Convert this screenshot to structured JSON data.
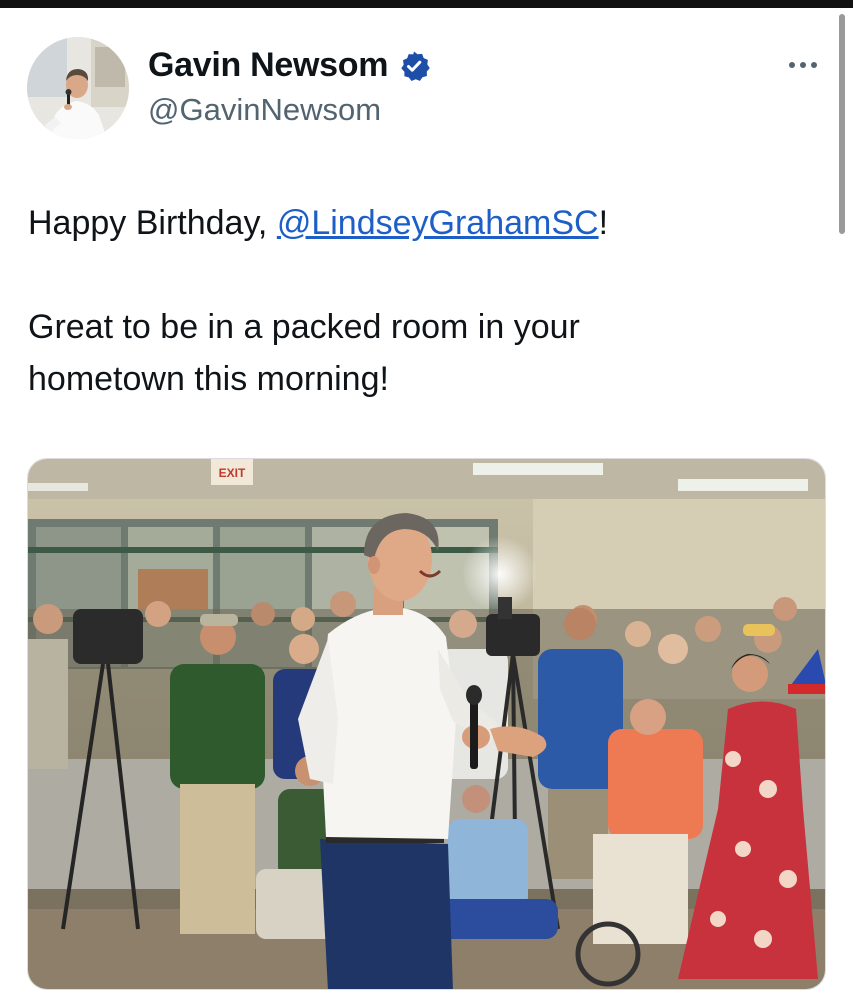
{
  "post": {
    "author": {
      "display_name": "Gavin Newsom",
      "handle": "@GavinNewsom",
      "verified": true,
      "avatar_icon": "profile-photo",
      "verified_icon": "verified-badge-icon"
    },
    "text": {
      "line1_prefix": "Happy Birthday, ",
      "mention": "@LindseyGrahamSC",
      "line1_suffix": "!",
      "line2a": "Great to be in a packed room in your",
      "line2b": "hometown this morning!"
    },
    "media": {
      "type": "photo",
      "exit_sign_text": "EXIT"
    }
  },
  "colors": {
    "text_primary": "#0f1419",
    "text_secondary": "#536471",
    "link": "#1d5fc7",
    "verified_badge": "#1d4fa8"
  },
  "icons": {
    "more": "more-horizontal-icon"
  }
}
